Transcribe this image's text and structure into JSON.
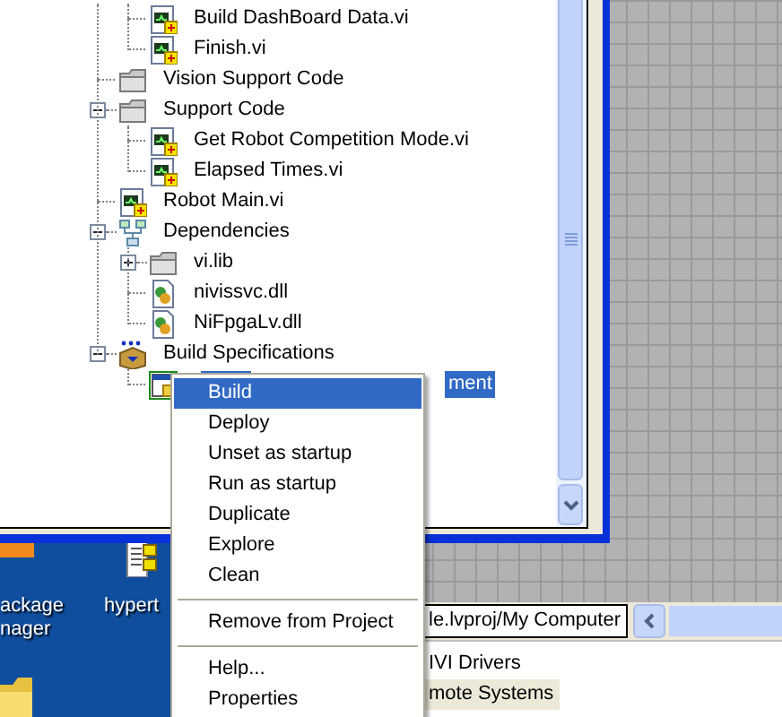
{
  "project_tree": {
    "items": [
      {
        "children": [
          {
            "label": "Build DashBoard Data.vi",
            "kind": "vi",
            "selected": false
          },
          {
            "label": "Finish.vi",
            "kind": "vi",
            "selected": false
          }
        ]
      },
      {
        "label": "Vision Support Code",
        "kind": "folder",
        "selected": false
      },
      {
        "label": "Support Code",
        "kind": "folder",
        "selected": false,
        "expanded": true,
        "children": [
          {
            "label": "Get Robot Competition Mode.vi",
            "kind": "vi",
            "selected": false
          },
          {
            "label": "Elapsed Times.vi",
            "kind": "vi",
            "selected": false
          }
        ]
      },
      {
        "label": "Robot Main.vi",
        "kind": "vi",
        "selected": false
      },
      {
        "label": "Dependencies",
        "kind": "dependencies",
        "selected": false,
        "expanded": true,
        "children": [
          {
            "label": "vi.lib",
            "kind": "folder",
            "selected": false,
            "expanded": false
          },
          {
            "label": "nivissvc.dll",
            "kind": "dll",
            "selected": false
          },
          {
            "label": "NiFpgaLv.dll",
            "kind": "dll",
            "selected": false
          }
        ]
      },
      {
        "label": "Build Specifications",
        "kind": "build",
        "selected": false,
        "expanded": true,
        "children": [
          {
            "label": "ment",
            "kind": "spec",
            "selected": true
          }
        ]
      }
    ]
  },
  "context_menu": {
    "items": [
      {
        "kind": "item",
        "label": "Build",
        "selected": true
      },
      {
        "kind": "item",
        "label": "Deploy",
        "selected": false
      },
      {
        "kind": "item",
        "label": "Unset as startup",
        "selected": false
      },
      {
        "kind": "item",
        "label": "Run as startup",
        "selected": false
      },
      {
        "kind": "item",
        "label": "Duplicate",
        "selected": false
      },
      {
        "kind": "item",
        "label": "Explore",
        "selected": false
      },
      {
        "kind": "item",
        "label": "Clean",
        "selected": false
      },
      {
        "kind": "separator"
      },
      {
        "kind": "item",
        "label": "Remove from Project",
        "selected": false
      },
      {
        "kind": "separator"
      },
      {
        "kind": "item",
        "label": "Help...",
        "selected": false
      },
      {
        "kind": "item",
        "label": "Properties",
        "selected": false
      }
    ]
  },
  "desktop_icons": [
    {
      "label": "ackage nager",
      "kind": "package"
    },
    {
      "label": "hypert",
      "kind": "document"
    },
    {
      "kind": "folder"
    }
  ],
  "bottom_window": {
    "path": "le.lvproj/My Computer",
    "items": [
      {
        "label": "IVI Drivers",
        "selected": false
      },
      {
        "label": "mote Systems",
        "selected": true
      }
    ]
  }
}
